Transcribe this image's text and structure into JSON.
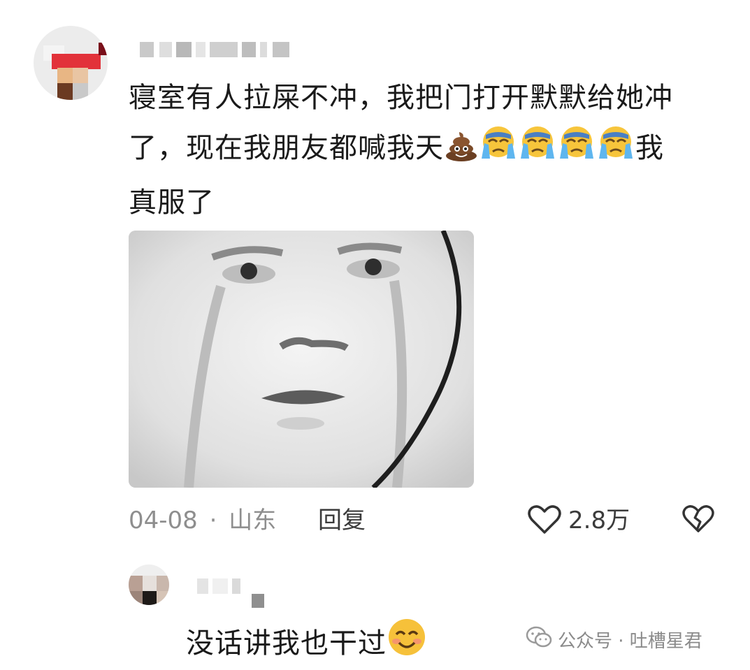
{
  "comment": {
    "text_line1": "寝室有人拉屎不冲，我把门打开默默给她冲",
    "text_line2_prefix": "了，现在我朋友都喊我天",
    "text_line2_suffix": "我",
    "text_line3": "真服了",
    "emojis": [
      "poop-emoji",
      "crying-emoji",
      "crying-emoji",
      "crying-emoji",
      "crying-emoji"
    ],
    "date": "04-08",
    "separator": "·",
    "location": "山东",
    "reply_label": "回复",
    "like_count": "2.8万"
  },
  "sub_comment": {
    "text": "没话讲我也干过",
    "emoji": "smiling-emoji"
  },
  "watermark": {
    "text": "公众号 · 吐槽星君",
    "icon": "wechat-icon"
  },
  "colors": {
    "meta_gray": "#8e8e8e",
    "text_dark": "#1a1a1a"
  }
}
